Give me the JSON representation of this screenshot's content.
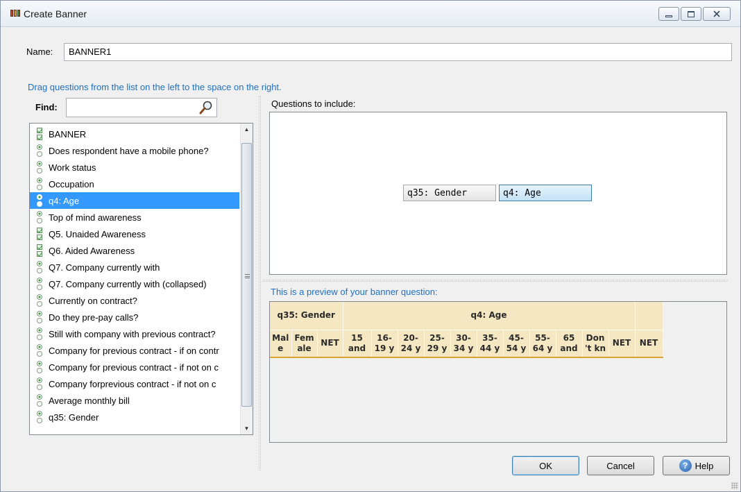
{
  "window": {
    "title": "Create Banner"
  },
  "name": {
    "label": "Name:",
    "value": "BANNER1"
  },
  "instructions": "Drag questions from the list on the left to the space on the right.",
  "find": {
    "label": "Find:",
    "value": ""
  },
  "questions": [
    {
      "label": "BANNER",
      "icon": "checkbox-icon"
    },
    {
      "label": "Does respondent have a mobile phone?",
      "icon": "radio-icon"
    },
    {
      "label": "Work status",
      "icon": "radio-icon"
    },
    {
      "label": "Occupation",
      "icon": "radio-icon"
    },
    {
      "label": "q4: Age",
      "icon": "radio-icon",
      "selected": true
    },
    {
      "label": "Top of mind awareness",
      "icon": "radio-icon"
    },
    {
      "label": "Q5. Unaided Awareness",
      "icon": "checkbox-icon"
    },
    {
      "label": "Q6. Aided Awareness",
      "icon": "checkbox-icon"
    },
    {
      "label": "Q7. Company currently with",
      "icon": "radio-icon"
    },
    {
      "label": "Q7. Company currently with (collapsed)",
      "icon": "radio-icon"
    },
    {
      "label": "Currently on contract?",
      "icon": "radio-icon"
    },
    {
      "label": "Do they pre-pay calls?",
      "icon": "radio-icon"
    },
    {
      "label": "Still with company with previous contract?",
      "icon": "radio-icon"
    },
    {
      "label": "Company for previous contract - if on contr",
      "icon": "radio-icon"
    },
    {
      "label": "Company for previous contract - if not on c",
      "icon": "radio-icon"
    },
    {
      "label": "Company forprevious contract - if not on c",
      "icon": "radio-icon"
    },
    {
      "label": "Average monthly bill",
      "icon": "radio-icon"
    },
    {
      "label": "q35: Gender",
      "icon": "radio-icon"
    }
  ],
  "include": {
    "label": "Questions to include:",
    "chips": [
      {
        "label": "q35: Gender",
        "selected": false
      },
      {
        "label": "q4: Age",
        "selected": true
      }
    ]
  },
  "preview": {
    "label": "This is a preview of your banner question:",
    "groups": [
      {
        "label": "q35: Gender",
        "columns": [
          [
            "Mal",
            "e"
          ],
          [
            "Fem",
            "ale"
          ],
          [
            "NET"
          ]
        ]
      },
      {
        "label": "q4: Age",
        "columns": [
          [
            "15",
            "and"
          ],
          [
            "16-",
            "19 y"
          ],
          [
            "20-",
            "24 y"
          ],
          [
            "25-",
            "29 y"
          ],
          [
            "30-",
            "34 y"
          ],
          [
            "35-",
            "44 y"
          ],
          [
            "45-",
            "54 y"
          ],
          [
            "55-",
            "64 y"
          ],
          [
            "65",
            "and"
          ],
          [
            "Don",
            "'t kn"
          ],
          [
            "NET"
          ]
        ]
      }
    ],
    "trailing_column": "NET"
  },
  "buttons": {
    "ok": "OK",
    "cancel": "Cancel",
    "help": "Help"
  },
  "colors": {
    "accent": "#1e6fbf",
    "selection": "#3399ff",
    "preview_cell": "#f5e7c1",
    "preview_rule": "#d9a232"
  }
}
